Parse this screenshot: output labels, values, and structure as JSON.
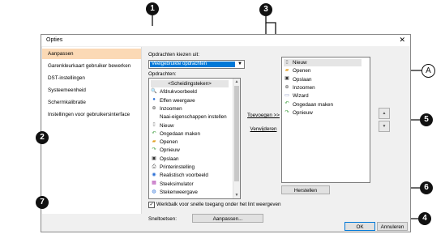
{
  "dialog": {
    "title": "Opties",
    "close_glyph": "✕"
  },
  "sidebar": {
    "items": [
      {
        "label": "Aanpassen",
        "selected": true
      },
      {
        "label": "Garenkleurkaart gebruiker bewerken",
        "selected": false
      },
      {
        "label": "DST-instellingen",
        "selected": false
      },
      {
        "label": "Systeemeenheid",
        "selected": false
      },
      {
        "label": "Schermkalibratie",
        "selected": false
      },
      {
        "label": "Instellingen voor gebruikersinterface",
        "selected": false
      }
    ]
  },
  "main": {
    "choose_label": "Opdrachten kiezen uit:",
    "combo_value": "Veelgebruikte opdrachten",
    "commands_label": "Opdrachten:",
    "commands": [
      {
        "label": "<Scheidingsteken>",
        "icon": ""
      },
      {
        "label": "Afdrukvoorbeeld",
        "icon": "print-preview-icon"
      },
      {
        "label": "Effen weergave",
        "icon": "solid-view-icon"
      },
      {
        "label": "Inzoomen",
        "icon": "zoom-in-icon"
      },
      {
        "label": "Naai-eigenschappen instellen",
        "icon": ""
      },
      {
        "label": "Nieuw",
        "icon": "new-file-icon"
      },
      {
        "label": "Ongedaan maken",
        "icon": "undo-icon"
      },
      {
        "label": "Openen",
        "icon": "open-folder-icon"
      },
      {
        "label": "Opnieuw",
        "icon": "redo-icon"
      },
      {
        "label": "Opslaan",
        "icon": "save-icon"
      },
      {
        "label": "Printerinstelling",
        "icon": "printer-icon"
      },
      {
        "label": "Realistisch voorbeeld",
        "icon": "realistic-view-icon"
      },
      {
        "label": "Steeksimulator",
        "icon": "stitch-simulator-icon"
      },
      {
        "label": "Stekenweergave",
        "icon": "stitch-view-icon"
      }
    ],
    "add_button": "Toevoegen >>",
    "remove_button": "Verwijderen",
    "toolbar_items": [
      {
        "label": "Nieuw",
        "icon": "new-file-icon"
      },
      {
        "label": "Openen",
        "icon": "open-folder-icon"
      },
      {
        "label": "Opslaan",
        "icon": "save-icon"
      },
      {
        "label": "Inzoomen",
        "icon": "zoom-in-icon"
      },
      {
        "label": "Wizard",
        "icon": "wizard-icon"
      },
      {
        "label": "Ongedaan maken",
        "icon": "undo-icon"
      },
      {
        "label": "Opnieuw",
        "icon": "redo-icon"
      }
    ],
    "reset_button": "Herstellen",
    "checkbox_label": "Werkbalk voor snelle toegang onder het lint weergeven",
    "checkbox_checked": true,
    "shortcuts_label": "Sneltoetsen:",
    "customize_button": "Aanpassen..."
  },
  "footer": {
    "ok_button": "OK",
    "cancel_button": "Annuleren"
  },
  "callouts": {
    "c1": "1",
    "c2": "2",
    "c3": "3",
    "c4": "4",
    "c5": "5",
    "c6": "6",
    "c7": "7",
    "cA": "A"
  }
}
